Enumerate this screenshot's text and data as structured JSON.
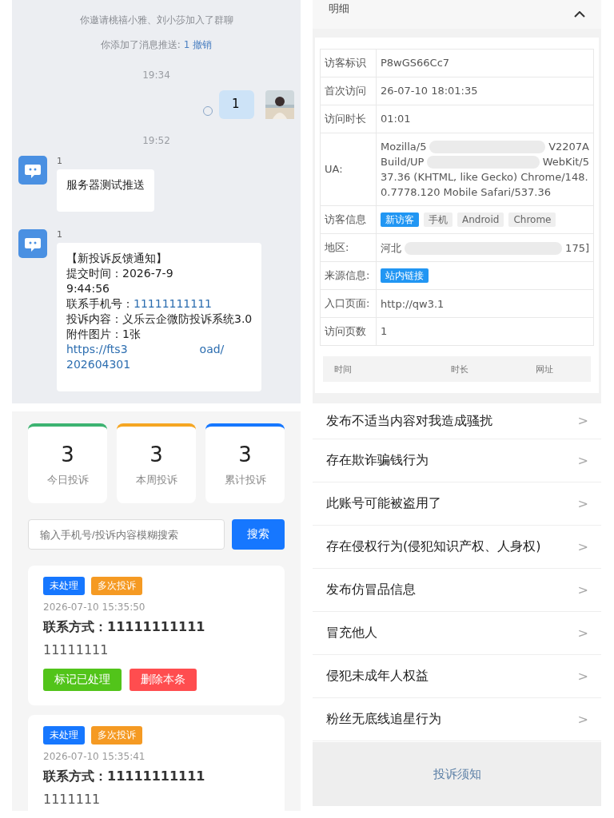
{
  "chat": {
    "system_lines": [
      {
        "text": "你邀请桃禧小雅、刘小莎加入了群聊"
      },
      {
        "text": "你添加了消息推送: ",
        "link": "1 撤销"
      }
    ],
    "messages": [
      {
        "kind": "time",
        "text": "19:34"
      },
      {
        "kind": "outgoing",
        "text": "1"
      },
      {
        "kind": "time",
        "text": "19:52"
      },
      {
        "kind": "incoming",
        "sender": "1",
        "lines": [
          {
            "text": "服务器测试推送"
          }
        ]
      },
      {
        "kind": "incoming",
        "sender": "1",
        "lines": [
          {
            "text": "【新投诉反馈通知】"
          },
          {
            "text": "提交时间：2026-7-9"
          },
          {
            "text": "9:44:56"
          },
          {
            "text": "联系手机号：",
            "link": "11111111111"
          },
          {
            "text": "投诉内容：义乐云企微防投诉系统3.0"
          },
          {
            "text": "附件图片：1张"
          },
          {
            "link": "https://fts3",
            "tail": "oad/"
          },
          {
            "link": "202604301"
          }
        ]
      }
    ]
  },
  "detail": {
    "title": "明细",
    "rows": [
      {
        "label": "访客标识",
        "kind": "text",
        "value": "P8wGS66Cc7"
      },
      {
        "label": "首次访问",
        "kind": "text",
        "value": "26-07-10 18:01:35"
      },
      {
        "label": "访问时长",
        "kind": "text",
        "value": "01:01"
      },
      {
        "label": "UA:",
        "kind": "lines",
        "lines": [
          [
            "Mozilla/5",
            "V2207A"
          ],
          [
            "Build/UP",
            "WebKit/5"
          ],
          [
            "37.36 (KHTML, like Gecko) Chrome/148."
          ],
          [
            "0.7778.120 Mobile Safari/537.36"
          ]
        ]
      },
      {
        "label": "访客信息",
        "kind": "tags",
        "tags": [
          {
            "text": "新访客",
            "highlight": true
          },
          {
            "text": "手机",
            "highlight": false
          },
          {
            "text": "Android",
            "highlight": false
          },
          {
            "text": "Chrome",
            "highlight": false
          }
        ]
      },
      {
        "label": "地区:",
        "kind": "lines",
        "lines": [
          [
            "河北",
            "175]"
          ]
        ]
      },
      {
        "label": "来源信息:",
        "kind": "tags",
        "tags": [
          {
            "text": "站内链接",
            "highlight": true
          }
        ]
      },
      {
        "label": "入口页面:",
        "kind": "lines",
        "lines": [
          [
            "http://qw3.1"
          ]
        ]
      },
      {
        "label": "访问页数",
        "kind": "text",
        "value": "1"
      }
    ],
    "history_columns": [
      "时间",
      "时长",
      "网址"
    ]
  },
  "dashboard": {
    "stats": [
      {
        "value": "3",
        "label": "今日投诉",
        "color": "#3cb371"
      },
      {
        "value": "3",
        "label": "本周投诉",
        "color": "#f5a623"
      },
      {
        "value": "3",
        "label": "累计投诉",
        "color": "#1677ff"
      }
    ],
    "search": {
      "placeholder": "输入手机号/投诉内容模糊搜索",
      "button": "搜索"
    },
    "complaints": [
      {
        "tags": [
          {
            "text": "未处理",
            "kind": "status"
          },
          {
            "text": "多次投诉",
            "kind": "repeat"
          }
        ],
        "time": "2026-07-10 15:35:50",
        "contact": "联系方式：11111111111",
        "content": "11111111",
        "actions": [
          {
            "text": "标记已处理",
            "kind": "done"
          },
          {
            "text": "删除本条",
            "kind": "delete"
          }
        ]
      },
      {
        "tags": [
          {
            "text": "未处理",
            "kind": "status"
          },
          {
            "text": "多次投诉",
            "kind": "repeat"
          }
        ],
        "time": "2026-07-10 15:35:41",
        "contact": "联系方式：11111111111",
        "content": "1111111"
      }
    ]
  },
  "reasons": {
    "items": [
      {
        "text": "发布不适当内容对我造成骚扰",
        "chevron": ">"
      },
      {
        "text": "存在欺诈骗钱行为",
        "chevron": ">"
      },
      {
        "text": "此账号可能被盗用了",
        "chevron": ">"
      },
      {
        "text": "存在侵权行为(侵犯知识产权、人身权)",
        "chevron": ">"
      },
      {
        "text": "发布仿冒品信息",
        "chevron": ">"
      },
      {
        "text": "冒充他人",
        "chevron": ">"
      },
      {
        "text": "侵犯未成年人权益",
        "chevron": ">"
      },
      {
        "text": "粉丝无底线追星行为",
        "chevron": ">"
      }
    ],
    "footer_link": "投诉须知"
  }
}
